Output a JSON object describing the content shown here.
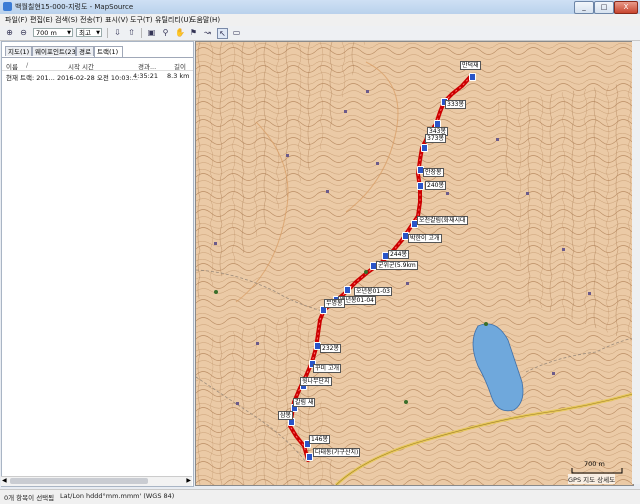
{
  "window": {
    "title": "백월칠현15-000-지렁도 - MapSource",
    "minimize": "_",
    "maximize": "□",
    "close": "X"
  },
  "menu": [
    {
      "label": "파일(F)"
    },
    {
      "label": "편집(E)"
    },
    {
      "label": "검색(S)"
    },
    {
      "label": "전송(T)"
    },
    {
      "label": "표시(V)"
    },
    {
      "label": "도구(T)"
    },
    {
      "label": "유틸리티(U)"
    },
    {
      "label": "도움말(H)"
    }
  ],
  "toolbar": {
    "zoom_value": "700 m",
    "detail_value": "최고"
  },
  "left_pane": {
    "tabs": [
      {
        "label": "지도(1)"
      },
      {
        "label": "웨이포인트(23)"
      },
      {
        "label": "경로"
      },
      {
        "label": "트랙(1)"
      }
    ],
    "active_tab": "트랙(1)",
    "columns": [
      "이름",
      "시작 시간",
      "경과...",
      "길이"
    ],
    "sort_indicator": "/",
    "tracks": [
      {
        "name": "현재 트랙: 201...",
        "start": "2016-02-28 오전 10:03:...",
        "elapsed": "4:35:21",
        "length": "8.3 km"
      }
    ]
  },
  "map": {
    "waypoints": [
      {
        "label": "만덕재"
      },
      {
        "label": "333봉"
      },
      {
        "label": "343봉"
      },
      {
        "label": "373봉"
      },
      {
        "label": "안장봉"
      },
      {
        "label": "240봉"
      },
      {
        "label": "오천갈림(화재시대"
      },
      {
        "label": "박한이 고개"
      },
      {
        "label": "244봉"
      },
      {
        "label": "군위군(5.9km"
      },
      {
        "label": "오년봉01-03"
      },
      {
        "label": "백년봉01-04"
      },
      {
        "label": "무명봉"
      },
      {
        "label": "232봉"
      },
      {
        "label": "꾸미 고개"
      },
      {
        "label": "윗나무단지"
      },
      {
        "label": "갈림 새"
      },
      {
        "label": "삼봉"
      },
      {
        "label": "146봉"
      },
      {
        "label": "다태동(가구산치)"
      }
    ],
    "scale_label": "700 m",
    "credit": "GPS 지도 상세도"
  },
  "status": {
    "selection": "0개 항목이 선택됨",
    "coords": "Lat/Lon hddd°mm.mmm' (WGS 84)"
  },
  "colors": {
    "terrain": "#e8c4a0",
    "contour": "#b5865c",
    "track": "#cc0000",
    "water": "#6fa8dc",
    "road": "#e7c85a",
    "waypoint": "#2a55c8"
  }
}
